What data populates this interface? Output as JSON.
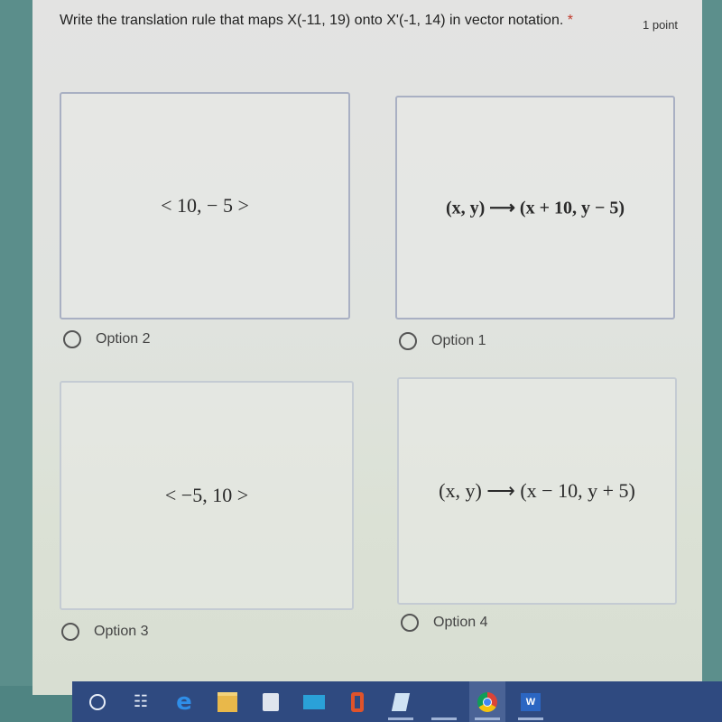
{
  "question": {
    "text": "Write the translation rule that maps X(-11, 19) onto X'(-1, 14) in vector notation.",
    "required_marker": "*",
    "points": "1 point"
  },
  "options": [
    {
      "label": "Option 2",
      "math": "< 10,  − 5 >"
    },
    {
      "label": "Option 1",
      "math": "(x, y)  ⟶  (x + 10, y − 5)"
    },
    {
      "label": "Option 3",
      "math": "< −5, 10 >"
    },
    {
      "label": "Option 4",
      "math": "(x, y) ⟶ (x − 10, y + 5)"
    }
  ],
  "taskbar": {
    "icons": [
      "cortana-search-icon",
      "task-view-icon",
      "edge-icon",
      "file-explorer-icon",
      "store-icon",
      "mail-icon",
      "office-icon",
      "notepad-icon",
      "blank-app-icon",
      "chrome-icon",
      "word-icon"
    ],
    "word_letter": "W"
  },
  "colors": {
    "background_teal": "#4f8482",
    "card": "#e2e3e1",
    "border": "#a9b0c3",
    "taskbar": "#2f4a80"
  }
}
